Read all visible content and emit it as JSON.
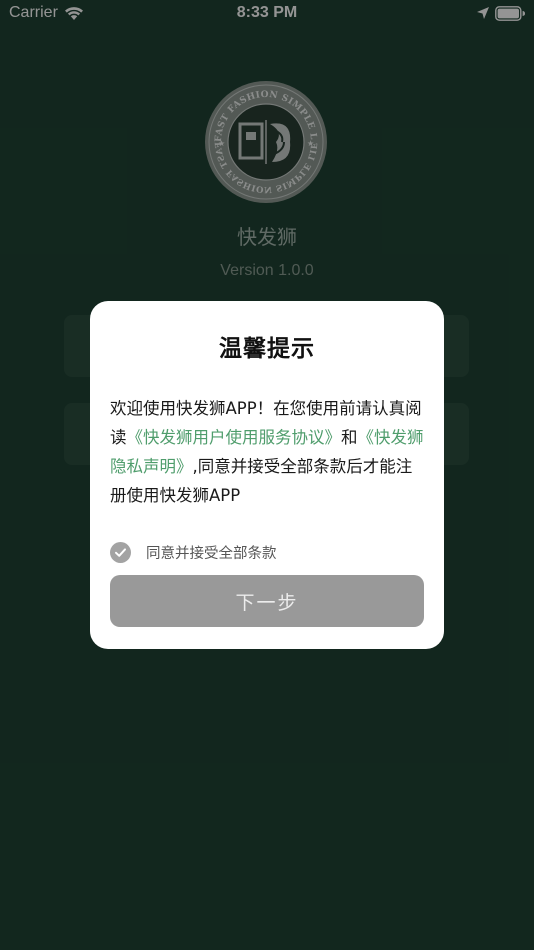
{
  "status_bar": {
    "carrier": "Carrier",
    "time": "8:33 PM",
    "wifi_icon": "wifi-icon",
    "location_icon": "location-arrow-icon",
    "battery_icon": "battery-icon"
  },
  "app": {
    "logo_text_top": "FAST FASHION SIMPLE LIFESTYLE",
    "logo_text_bottom": "FAST FASHION SIMPLE LIFESTYLE",
    "name": "快发狮",
    "version": "Version 1.0.0"
  },
  "dialog": {
    "title": "温馨提示",
    "body_prefix": "欢迎使用快发狮APP！在您使用前请认真阅读",
    "link_service": "《快发狮用户使用服务协议》",
    "body_and": "和",
    "link_privacy": "《快发狮隐私声明》",
    "body_suffix": ",同意并接受全部条款后才能注册使用快发狮APP",
    "agree_label": "同意并接受全部条款",
    "agree_checked": true,
    "next_label": "下一步"
  },
  "colors": {
    "background": "#1f4334",
    "link": "#4f9d6c",
    "button_disabled": "#999999",
    "checkbox": "#a3a3a3"
  }
}
